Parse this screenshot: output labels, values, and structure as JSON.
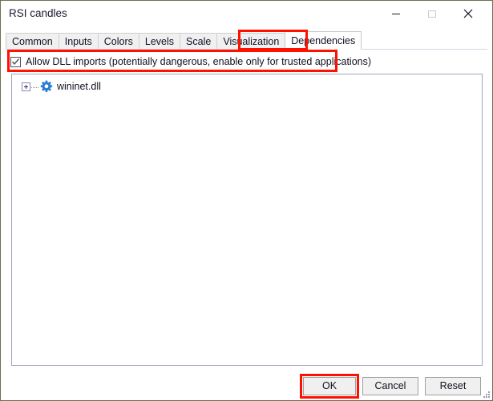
{
  "window": {
    "title": "RSI candles",
    "controls": [
      {
        "name": "minimize",
        "glyph": "minimize-icon",
        "label": "Minimize"
      },
      {
        "name": "maximize",
        "glyph": "maximize-icon",
        "label": "Maximize",
        "disabled": true
      },
      {
        "name": "close",
        "glyph": "close-icon",
        "label": "Close"
      }
    ]
  },
  "tabs": [
    {
      "label": "Common",
      "active": false
    },
    {
      "label": "Inputs",
      "active": false
    },
    {
      "label": "Colors",
      "active": false
    },
    {
      "label": "Levels",
      "active": false
    },
    {
      "label": "Scale",
      "active": false
    },
    {
      "label": "Visualization",
      "active": false
    },
    {
      "label": "Dependencies",
      "active": true
    }
  ],
  "dependencies_page": {
    "allow_dll_imports": {
      "label": "Allow DLL imports (potentially dangerous, enable only for trusted applications)",
      "checked": true
    },
    "tree": [
      {
        "label": "wininet.dll",
        "icon": "gear-icon",
        "expanded": false,
        "expander": "plus-icon"
      }
    ]
  },
  "footer": {
    "ok_label": "OK",
    "cancel_label": "Cancel",
    "reset_label": "Reset"
  },
  "annotations": {
    "accent_color": "#ff1100",
    "highlighted": [
      "Dependencies tab",
      "Allow DLL imports checkbox row",
      "OK button"
    ]
  },
  "colors": {
    "window_border": "#6f6f52",
    "dialog_background": "#ffffff",
    "tab_inactive": "#f0f0f0",
    "tab_active": "#ffffff",
    "button_face": "#f0f0f0",
    "gear_blue": "#2d7dd2",
    "text": "#101020"
  }
}
